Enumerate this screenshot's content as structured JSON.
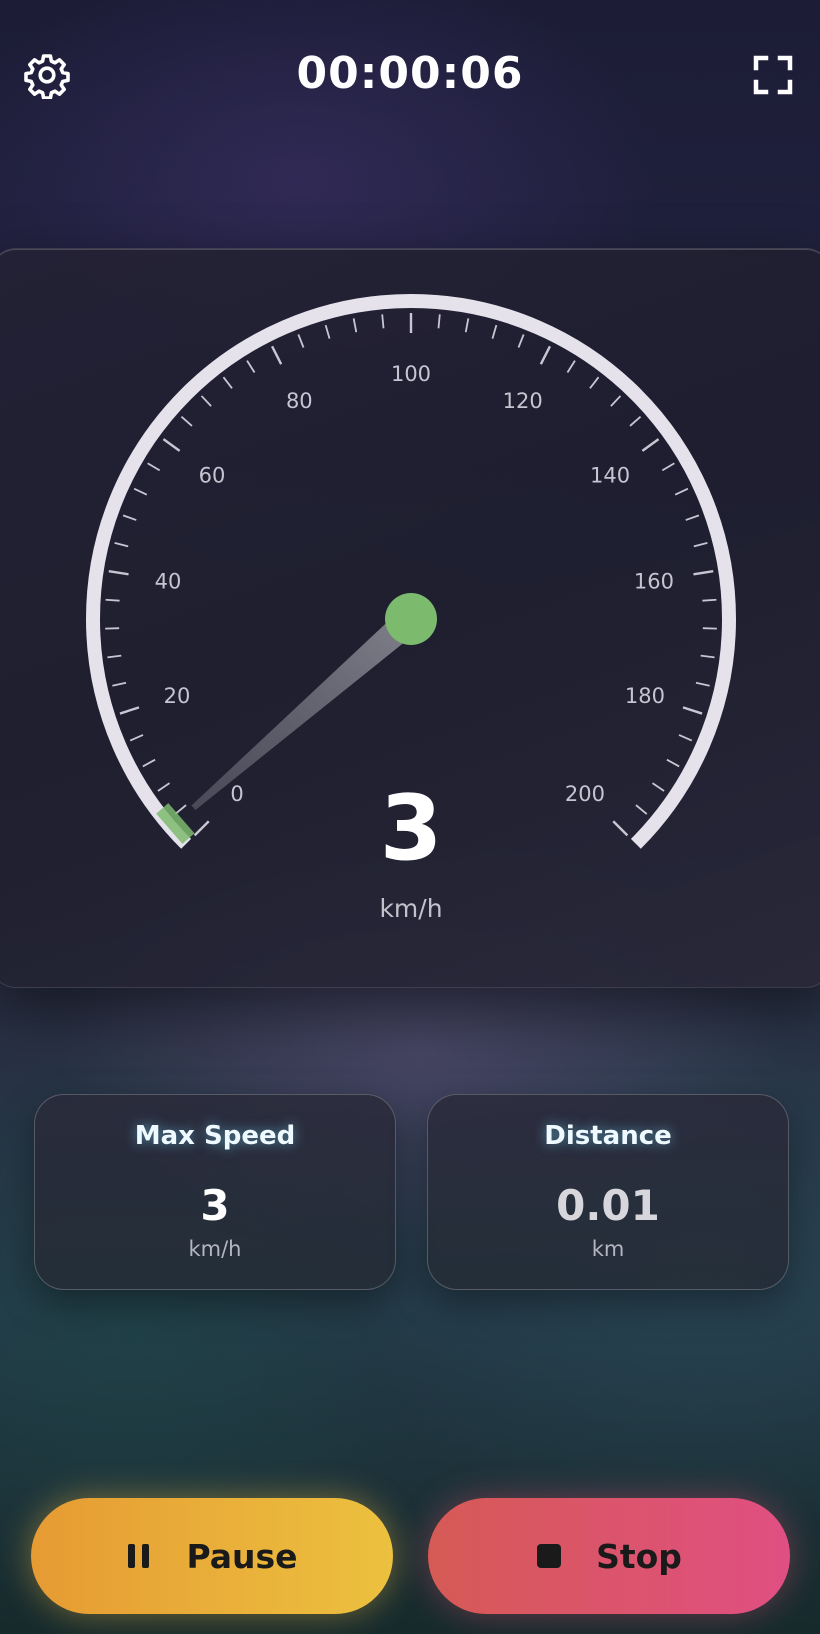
{
  "header": {
    "timer": "00:00:06",
    "settings_icon": "gear-icon",
    "fullscreen_icon": "fullscreen-icon"
  },
  "speedometer": {
    "current_speed": "3",
    "unit": "km/h",
    "min": 0,
    "max": 200,
    "tick_labels": [
      "0",
      "20",
      "40",
      "60",
      "80",
      "100",
      "120",
      "140",
      "160",
      "180",
      "200"
    ],
    "needle_value": 3,
    "needle_color": "#7cba6e",
    "dial_color": "#e6e2ec"
  },
  "stats": {
    "max_speed": {
      "label": "Max Speed",
      "value": "3",
      "unit": "km/h"
    },
    "distance": {
      "label": "Distance",
      "value": "0.01",
      "unit": "km"
    }
  },
  "actions": {
    "pause_label": "Pause",
    "pause_icon": "pause-icon",
    "stop_label": "Stop",
    "stop_icon": "stop-icon"
  },
  "colors": {
    "pause_gradient": [
      "#e69b33",
      "#ecc13f"
    ],
    "stop_gradient": [
      "#d65a55",
      "#e04f82"
    ],
    "stat_title_glow": "#78dcff",
    "distance_value": "#d6d6dc",
    "max_speed_value": "#ffffff"
  }
}
